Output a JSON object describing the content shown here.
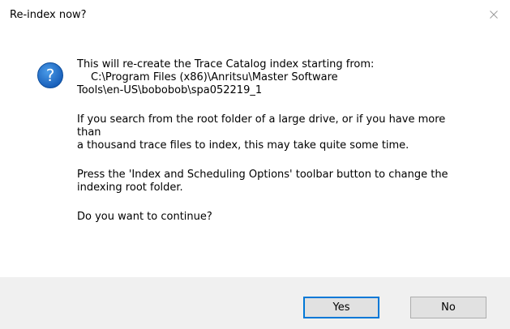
{
  "window": {
    "title": "Re-index now?",
    "close_icon": "close-icon"
  },
  "icon": {
    "name": "question-icon",
    "glyph": "?",
    "color": "#1e6fc9"
  },
  "message": {
    "intro": "This will re-create the Trace Catalog index starting from:",
    "path_line_1": "C:\\Program Files (x86)\\Anritsu\\Master Software",
    "path_line_2": "Tools\\en-US\\bobobob\\spa052219_1",
    "warning_line_1": "If you search from the root folder of a large drive, or if you have more",
    "warning_line_2": "than",
    "warning_line_3": "a thousand trace files to index, this may take quite some time.",
    "options_line_1": "Press the 'Index and Scheduling Options' toolbar button to change the",
    "options_line_2": "indexing root folder.",
    "question": "Do you want to continue?"
  },
  "buttons": {
    "yes_label": "Yes",
    "no_label": "No"
  },
  "colors": {
    "footer_bg": "#f0f0f0",
    "focus_border": "#0078d7"
  }
}
